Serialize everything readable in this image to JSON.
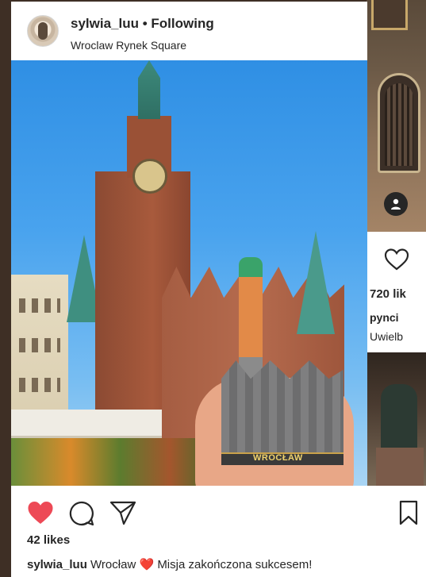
{
  "post": {
    "username": "sylwia_luu",
    "follow_status": "Following",
    "location": "Wroclaw Rynek Square",
    "likes": "42 likes",
    "caption": {
      "username": "sylwia_luu",
      "text_before": "Wrocław",
      "emoji": "❤️",
      "text_after": "Misja zakończona sukcesem!"
    },
    "souvenir_label": "WROCŁAW"
  },
  "background_post": {
    "likes_partial": "720 lik",
    "caption_user_partial": "pynci",
    "caption_partial": "Uwielb"
  },
  "icons": {
    "like": "heart-filled-icon",
    "comment": "comment-icon",
    "share": "send-icon",
    "save": "bookmark-icon",
    "background_like": "heart-outline-icon",
    "background_tag": "person-tag-icon"
  },
  "colors": {
    "like_red": "#ed4956",
    "text": "#262626",
    "page_background": "#3e2f25"
  }
}
